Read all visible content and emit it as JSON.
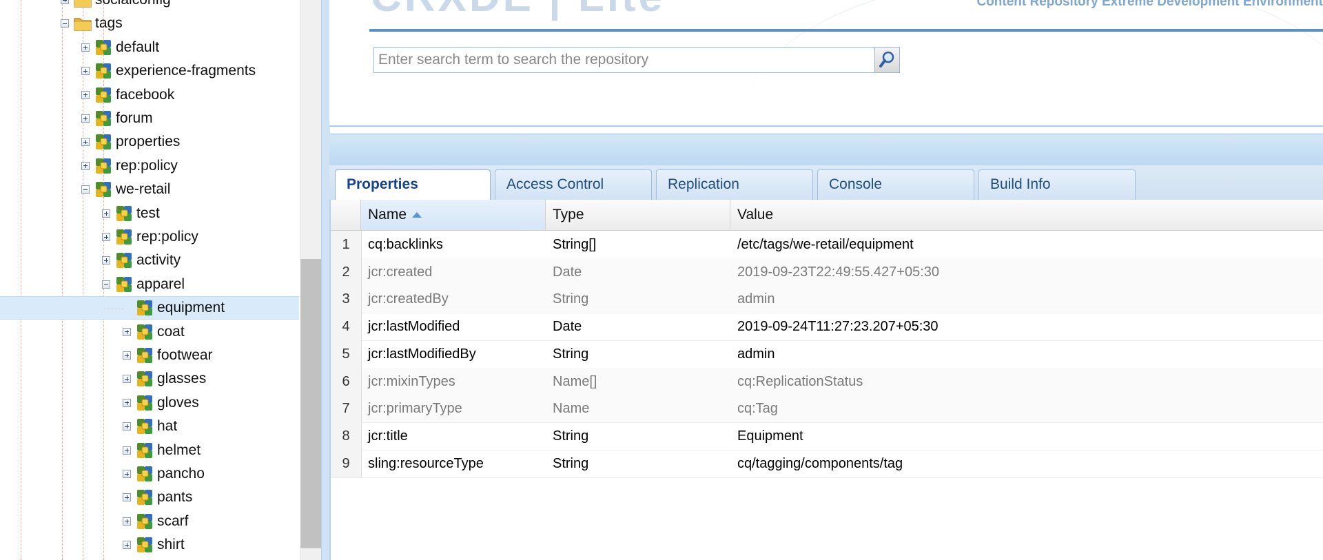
{
  "tree": {
    "items": [
      {
        "label": "socialconfig",
        "icon": "folder-icon",
        "expander": "plus"
      },
      {
        "label": "tags",
        "icon": "folder-icon",
        "expander": "minus"
      },
      {
        "label": "default",
        "icon": "tag-node-icon",
        "expander": "plus"
      },
      {
        "label": "experience-fragments",
        "icon": "tag-node-icon",
        "expander": "plus"
      },
      {
        "label": "facebook",
        "icon": "tag-node-icon",
        "expander": "plus"
      },
      {
        "label": "forum",
        "icon": "tag-node-icon",
        "expander": "plus"
      },
      {
        "label": "properties",
        "icon": "tag-node-icon",
        "expander": "plus"
      },
      {
        "label": "rep:policy",
        "icon": "tag-node-icon",
        "expander": "plus"
      },
      {
        "label": "we-retail",
        "icon": "tag-node-icon",
        "expander": "minus"
      },
      {
        "label": "test",
        "icon": "tag-node-icon",
        "expander": "plus"
      },
      {
        "label": "rep:policy",
        "icon": "tag-node-icon",
        "expander": "plus"
      },
      {
        "label": "activity",
        "icon": "tag-node-icon",
        "expander": "plus"
      },
      {
        "label": "apparel",
        "icon": "tag-node-icon",
        "expander": "minus"
      },
      {
        "label": "equipment",
        "icon": "tag-node-icon",
        "expander": "none",
        "selected": true
      },
      {
        "label": "coat",
        "icon": "tag-node-icon",
        "expander": "plus"
      },
      {
        "label": "footwear",
        "icon": "tag-node-icon",
        "expander": "plus"
      },
      {
        "label": "glasses",
        "icon": "tag-node-icon",
        "expander": "plus"
      },
      {
        "label": "gloves",
        "icon": "tag-node-icon",
        "expander": "plus"
      },
      {
        "label": "hat",
        "icon": "tag-node-icon",
        "expander": "plus"
      },
      {
        "label": "helmet",
        "icon": "tag-node-icon",
        "expander": "plus"
      },
      {
        "label": "pancho",
        "icon": "tag-node-icon",
        "expander": "plus"
      },
      {
        "label": "pants",
        "icon": "tag-node-icon",
        "expander": "plus"
      },
      {
        "label": "scarf",
        "icon": "tag-node-icon",
        "expander": "plus"
      },
      {
        "label": "shirt",
        "icon": "tag-node-icon",
        "expander": "plus"
      }
    ]
  },
  "header": {
    "logo_text": "CRXDE | Lite",
    "subtitle": "Content Repository Extreme Development Environment"
  },
  "search": {
    "placeholder": "Enter search term to search the repository",
    "button_icon": "search-icon"
  },
  "tabs": [
    {
      "label": "Properties",
      "active": true
    },
    {
      "label": "Access Control"
    },
    {
      "label": "Replication"
    },
    {
      "label": "Console"
    },
    {
      "label": "Build Info"
    }
  ],
  "properties": {
    "columns": {
      "name": "Name",
      "type": "Type",
      "value": "Value"
    },
    "sort_column": "Name",
    "rows": [
      {
        "num": "1",
        "name": "cq:backlinks",
        "type": "String[]",
        "value": "/etc/tags/we-retail/equipment",
        "dim": false
      },
      {
        "num": "2",
        "name": "jcr:created",
        "type": "Date",
        "value": "2019-09-23T22:49:55.427+05:30",
        "dim": true
      },
      {
        "num": "3",
        "name": "jcr:createdBy",
        "type": "String",
        "value": "admin",
        "dim": true
      },
      {
        "num": "4",
        "name": "jcr:lastModified",
        "type": "Date",
        "value": "2019-09-24T11:27:23.207+05:30",
        "dim": false
      },
      {
        "num": "5",
        "name": "jcr:lastModifiedBy",
        "type": "String",
        "value": "admin",
        "dim": false
      },
      {
        "num": "6",
        "name": "jcr:mixinTypes",
        "type": "Name[]",
        "value": "cq:ReplicationStatus",
        "dim": true
      },
      {
        "num": "7",
        "name": "jcr:primaryType",
        "type": "Name",
        "value": "cq:Tag",
        "dim": true
      },
      {
        "num": "8",
        "name": "jcr:title",
        "type": "String",
        "value": "Equipment",
        "dim": false
      },
      {
        "num": "9",
        "name": "sling:resourceType",
        "type": "String",
        "value": "cq/tagging/components/tag",
        "dim": false
      }
    ]
  },
  "colors": {
    "selection": "#d9ebfb",
    "tab_text": "#15428b",
    "header_rule": "#5b90c7"
  }
}
